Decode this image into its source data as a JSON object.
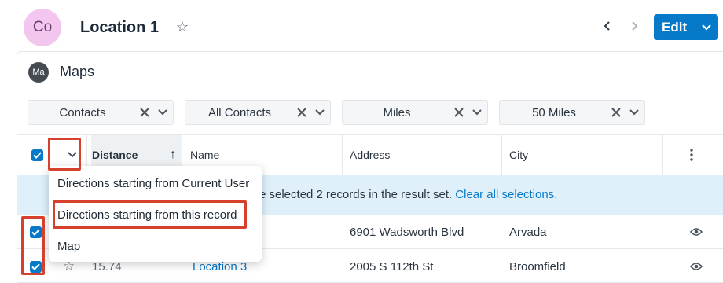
{
  "header": {
    "avatar": "Co",
    "title": "Location 1",
    "edit_label": "Edit"
  },
  "dashlet": {
    "avatar": "Ma",
    "title": "Maps",
    "filters": [
      {
        "value": "Contacts"
      },
      {
        "value": "All Contacts"
      },
      {
        "value": "Miles"
      },
      {
        "value": "50 Miles"
      }
    ]
  },
  "table": {
    "columns": [
      "Distance",
      "Name",
      "Address",
      "City"
    ],
    "sort_indicator": "↑",
    "banner": {
      "text": "e selected 2 records in the result set. ",
      "link": "Clear all selections."
    },
    "rows": [
      {
        "distance": "",
        "name": "",
        "address": "6901 Wadsworth Blvd",
        "city": "Arvada"
      },
      {
        "distance": "15.74",
        "name": "Location 3",
        "address": "2005 S 112th St",
        "city": "Broomfield"
      }
    ]
  },
  "menu": {
    "items": [
      "Directions starting from Current User",
      "Directions starting from this record",
      "Map"
    ]
  },
  "colors": {
    "accent": "#0679c8",
    "highlight": "#d5412d",
    "banner_bg": "#dff0fb"
  },
  "icons": [
    "star-icon",
    "chevron-left-icon",
    "chevron-right-icon",
    "chevron-down-icon",
    "clear-icon",
    "sort-asc-icon",
    "more-vertical-icon",
    "eye-icon",
    "checkbox-checked-icon"
  ]
}
